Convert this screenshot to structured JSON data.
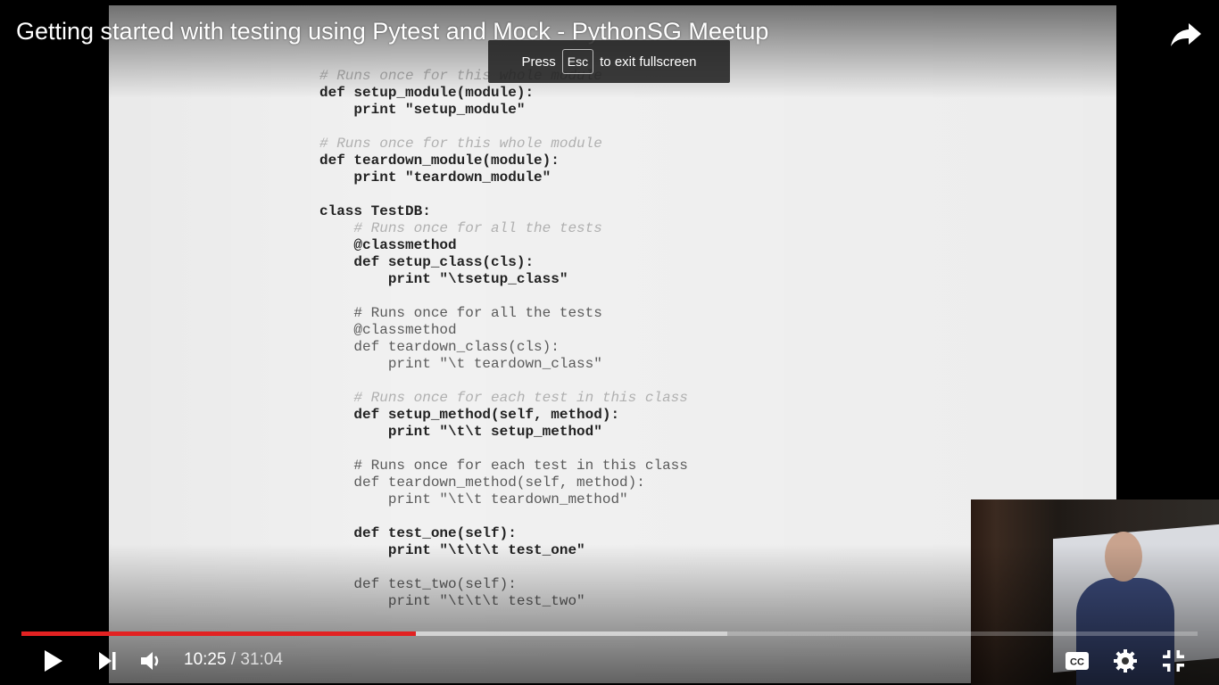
{
  "video": {
    "title": "Getting started with testing using Pytest and Mock - PythonSG Meetup",
    "progress": 0.3355,
    "buffered": 0.6
  },
  "toast": {
    "press": "Press",
    "key": "Esc",
    "suffix": "to exit fullscreen"
  },
  "time": {
    "current": "10:25",
    "separator": " / ",
    "duration": "31:04"
  },
  "code_lines": [
    {
      "text": "# Runs once for this whole module",
      "style": "c"
    },
    {
      "text": "def setup_module(module):",
      "style": "b"
    },
    {
      "text": "    print \"setup_module\"",
      "style": "b"
    },
    {
      "text": "",
      "style": "n"
    },
    {
      "text": "# Runs once for this whole module",
      "style": "c"
    },
    {
      "text": "def teardown_module(module):",
      "style": "b"
    },
    {
      "text": "    print \"teardown_module\"",
      "style": "b"
    },
    {
      "text": "",
      "style": "n"
    },
    {
      "text": "class TestDB:",
      "style": "b"
    },
    {
      "text": "    # Runs once for all the tests",
      "style": "c"
    },
    {
      "text": "    @classmethod",
      "style": "b"
    },
    {
      "text": "    def setup_class(cls):",
      "style": "b"
    },
    {
      "text": "        print \"\\tsetup_class\"",
      "style": "b"
    },
    {
      "text": "",
      "style": "n"
    },
    {
      "text": "    # Runs once for all the tests",
      "style": "n"
    },
    {
      "text": "    @classmethod",
      "style": "n"
    },
    {
      "text": "    def teardown_class(cls):",
      "style": "n"
    },
    {
      "text": "        print \"\\t teardown_class\"",
      "style": "n"
    },
    {
      "text": "",
      "style": "n"
    },
    {
      "text": "    # Runs once for each test in this class",
      "style": "c"
    },
    {
      "text": "    def setup_method(self, method):",
      "style": "b"
    },
    {
      "text": "        print \"\\t\\t setup_method\"",
      "style": "b"
    },
    {
      "text": "",
      "style": "n"
    },
    {
      "text": "    # Runs once for each test in this class",
      "style": "n"
    },
    {
      "text": "    def teardown_method(self, method):",
      "style": "n"
    },
    {
      "text": "        print \"\\t\\t teardown_method\"",
      "style": "n"
    },
    {
      "text": "",
      "style": "n"
    },
    {
      "text": "    def test_one(self):",
      "style": "b"
    },
    {
      "text": "        print \"\\t\\t\\t test_one\"",
      "style": "b"
    },
    {
      "text": "",
      "style": "n"
    },
    {
      "text": "    def test_two(self):",
      "style": "n"
    },
    {
      "text": "        print \"\\t\\t\\t test_two\"",
      "style": "n"
    }
  ],
  "icons": {
    "share": "share-icon",
    "play": "play-icon",
    "next": "next-icon",
    "volume": "volume-icon",
    "cc": "cc-icon",
    "settings": "gear-icon",
    "exit_fullscreen": "exit-fullscreen-icon"
  },
  "colors": {
    "progress": "#e22222"
  }
}
